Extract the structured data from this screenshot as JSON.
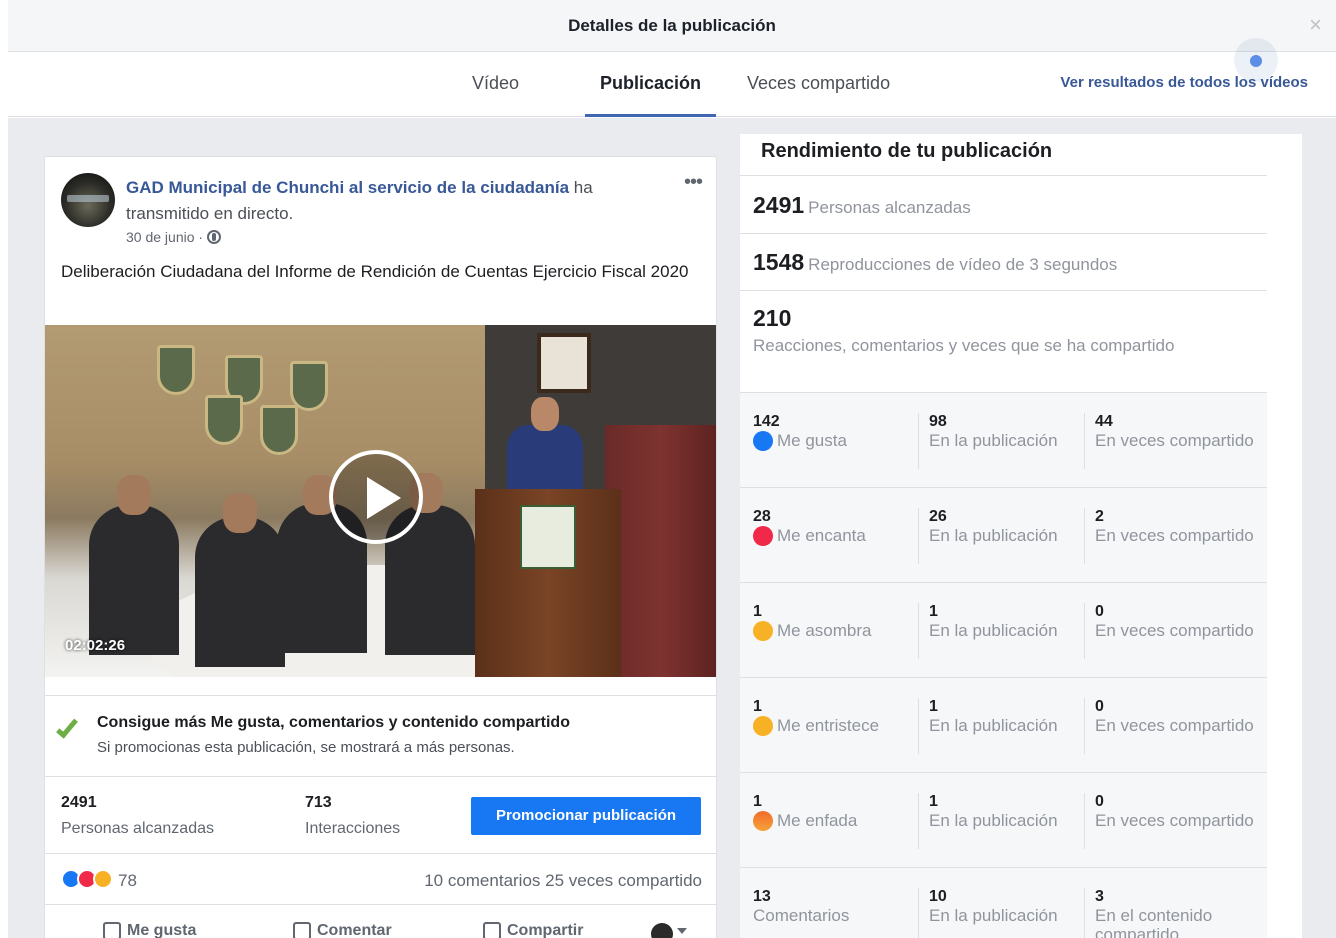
{
  "header": {
    "title": "Detalles de la publicación",
    "close_label": "×"
  },
  "tabs": [
    {
      "label": "Vídeo",
      "active": false
    },
    {
      "label": "Publicación",
      "active": true
    },
    {
      "label": "Veces compartido",
      "active": false
    }
  ],
  "see_all_link": "Ver resultados de todos los vídeos",
  "post": {
    "page_name": "GAD Municipal de Chunchi al servicio de la ciudadanía",
    "action_text": " ha transmitido en directo.",
    "date": "30 de junio ·",
    "more_label": "•••",
    "text": "Deliberación Ciudadana del Informe de Rendición de Cuentas Ejercicio Fiscal 2020",
    "video_duration": "02:02:26",
    "promo_title": "Consigue más Me gusta, comentarios y contenido compartido",
    "promo_subtitle": "Si promocionas esta publicación, se mostrará a más personas.",
    "reach_value": "2491",
    "reach_label": "Personas alcanzadas",
    "interactions_value": "713",
    "interactions_label": "Interacciones",
    "promote_button": "Promocionar publicación",
    "reaction_count": "78",
    "comments_shares": "10 comentarios  25 veces compartido",
    "actions": {
      "like": "Me gusta",
      "comment": "Comentar",
      "share": "Compartir"
    }
  },
  "performance": {
    "title": "Rendimiento de tu publicación",
    "reach": {
      "value": "2491",
      "label": "Personas alcanzadas"
    },
    "video_plays": {
      "value": "1548",
      "label": "Reproducciones de vídeo de 3 segundos"
    },
    "engagement": {
      "value": "210",
      "label": "Reacciones, comentarios y veces que se ha compartido"
    },
    "breakdown": [
      {
        "total": "142",
        "label": "Me gusta",
        "icon": "like",
        "on_post": "98",
        "on_post_label": "En la publicación",
        "shared": "44",
        "shared_label": "En veces compartido"
      },
      {
        "total": "28",
        "label": "Me encanta",
        "icon": "love",
        "on_post": "26",
        "on_post_label": "En la publicación",
        "shared": "2",
        "shared_label": "En veces compartido"
      },
      {
        "total": "1",
        "label": "Me asombra",
        "icon": "wow",
        "on_post": "1",
        "on_post_label": "En la publicación",
        "shared": "0",
        "shared_label": "En veces compartido"
      },
      {
        "total": "1",
        "label": "Me entristece",
        "icon": "sad",
        "on_post": "1",
        "on_post_label": "En la publicación",
        "shared": "0",
        "shared_label": "En veces compartido"
      },
      {
        "total": "1",
        "label": "Me enfada",
        "icon": "angry",
        "on_post": "1",
        "on_post_label": "En la publicación",
        "shared": "0",
        "shared_label": "En veces compartido"
      },
      {
        "total": "13",
        "label": "Comentarios",
        "icon": "",
        "on_post": "10",
        "on_post_label": "En la publicación",
        "shared": "3",
        "shared_label": "En el contenido compartido"
      }
    ]
  },
  "colors": {
    "accent": "#4267b2",
    "link": "#385898",
    "button": "#1877f2",
    "check": "#6dae45"
  }
}
